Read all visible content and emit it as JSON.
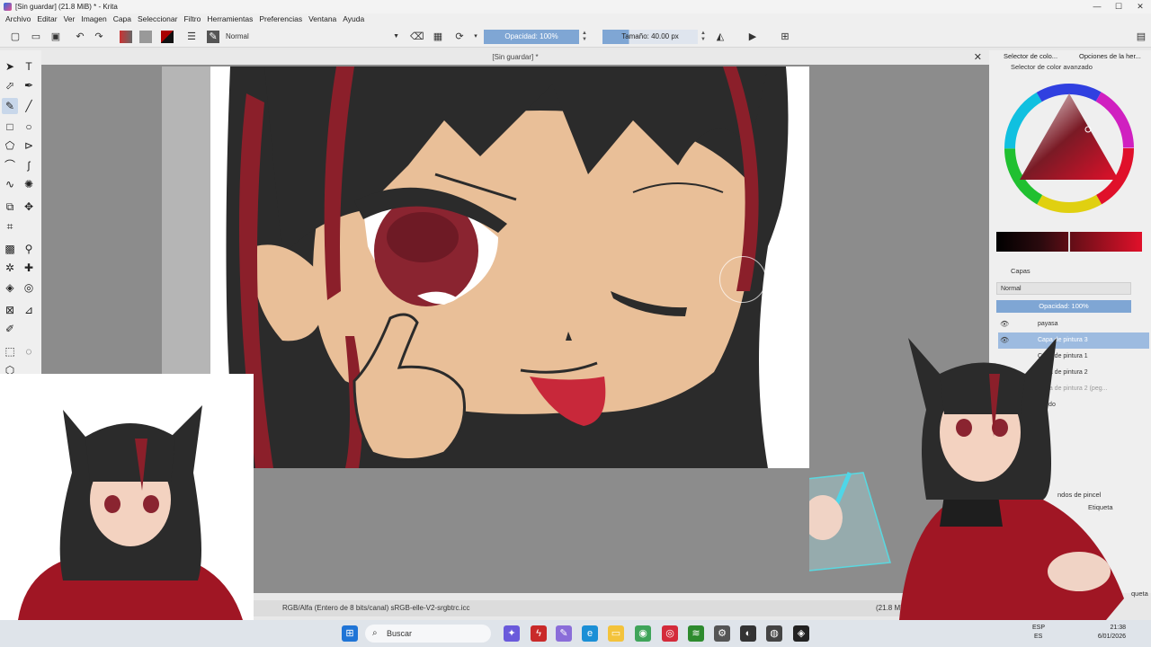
{
  "window": {
    "title": "[Sin guardar]  (21.8 MiB)  * - Krita",
    "controls": [
      "—",
      "☐",
      "✕"
    ]
  },
  "menu": [
    "Archivo",
    "Editar",
    "Ver",
    "Imagen",
    "Capa",
    "Seleccionar",
    "Filtro",
    "Herramientas",
    "Preferencias",
    "Ventana",
    "Ayuda"
  ],
  "toolbar": {
    "blend_mode": "Normal",
    "opacity_label": "Opacidad: 100%",
    "size_label": "Tamaño: 40.00 px"
  },
  "document": {
    "tab_title": "[Sin guardar] *",
    "status_color_profile": "RGB/Alfa (Entero de 8 bits/canal)  sRGB-elle-V2-srgbtrc.icc",
    "status_memory": "(21.8 MiB)"
  },
  "dock": {
    "tabs": [
      "Selector de colo...",
      "Opciones de la her..."
    ],
    "color_panel_title": "Selector de color avanzado",
    "layers_panel_title": "Capas",
    "layers_blend": "Normal",
    "layers_opacity": "Opacidad: 100%",
    "layers": [
      {
        "name": "payasa",
        "selected": false
      },
      {
        "name": "Capa de pintura 3",
        "selected": true
      },
      {
        "name": "Capa de pintura 1",
        "selected": false
      },
      {
        "name": "Capa de pintura 2",
        "selected": false
      },
      {
        "name": "Capa de pintura 2 (peg...",
        "selected": false
      },
      {
        "name": "Fondo",
        "selected": false
      }
    ],
    "brush_presets_title": "ndos de pincel",
    "brush_tag_label": "Etiqueta",
    "brush_footer": "queta"
  },
  "taskbar": {
    "search_placeholder": "Buscar",
    "lang_top": "ESP",
    "lang_bottom": "ES",
    "time": "21:38",
    "date": "6/01/2026"
  },
  "colors": {
    "hair": "#2b2b2b",
    "hair_red": "#8b1f2a",
    "skin": "#e9bf98",
    "eye": "#8a2430",
    "tongue": "#c8283a",
    "accent_blue": "#7fa6d4"
  }
}
